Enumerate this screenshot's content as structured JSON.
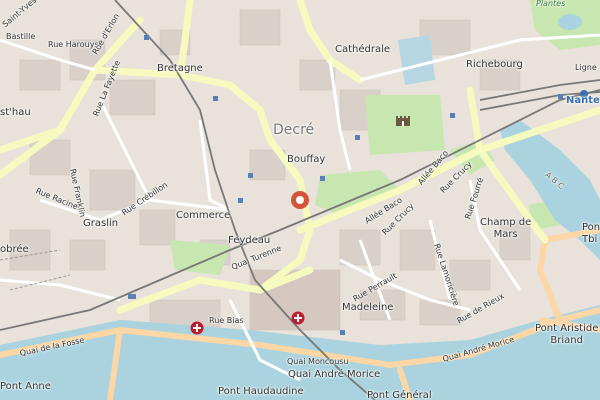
{
  "map": {
    "colors": {
      "land": "#f2efe9",
      "water": "#aad3df",
      "park": "#c8e6b0",
      "built": "#d9d0c9",
      "major_road": "#f7fabf",
      "secondary_road": "#fcd6a4",
      "rail": "#777777",
      "hospital": "#bd1e2d",
      "marker": "#d4533a"
    },
    "labels": {
      "bastille": "Bastille",
      "saint_yves": "Saint-Yves",
      "rue_harouys": "Rue Harouys",
      "rue_derlon": "Rue d'Erlon",
      "bretagne": "Bretagne",
      "cathedrale": "Cathédrale",
      "plantes": "Plantes",
      "richebourg": "Richebourg",
      "nantes": "Nantes",
      "ligne": "Ligne",
      "rue_la_fayette": "Rue La Fayette",
      "st_hau": "st'hau",
      "decre": "Decré",
      "bouffay": "Bouffay",
      "rue_franklin": "Rue Franklin",
      "rue_racine": "Rue Racine",
      "rue_crebillon": "Rue Crébillon",
      "graslin": "Graslin",
      "commerce": "Commerce",
      "obree": "obrée",
      "allee_baco_1": "Allée Baco",
      "allee_baco_2": "Allée Baco",
      "rue_crucy_1": "Rue Crucy",
      "rue_crucy_2": "Rue Crucy",
      "champ_de_mars": "Champ de\nMars",
      "rue_fourre": "Rue Fourré",
      "feydeau": "Feydeau",
      "quai_turenne": "Quai Turenne",
      "rue_perrault": "Rue Perrault",
      "rue_lamoriciere": "Rue Lamoricière",
      "madeleine": "Madeleine",
      "rue_de_rieux": "Rue de Rieux",
      "pont_tbi": "Pont\nTbi",
      "quai_de_la_fosse": "Quai de la Fosse",
      "rue_bias": "Rue Bias",
      "quai_andre_morice_1": "Quai André Morice",
      "pont_aristide_briand": "Pont Aristide\nBriand",
      "quai_moncousu": "Quai Moncousu",
      "quai_andre_morice_2": "Quai André Morice",
      "pont_anne": "Pont Anne",
      "pont_haudaudine": "Pont Haudaudine",
      "pont_general": "Pont Général",
      "abc": "A  B  C"
    },
    "icons": {
      "hospital": "hospital-cross-icon",
      "castle": "castle-icon",
      "marker": "location-marker-icon",
      "tram_stop": "tram-stop-icon"
    }
  }
}
